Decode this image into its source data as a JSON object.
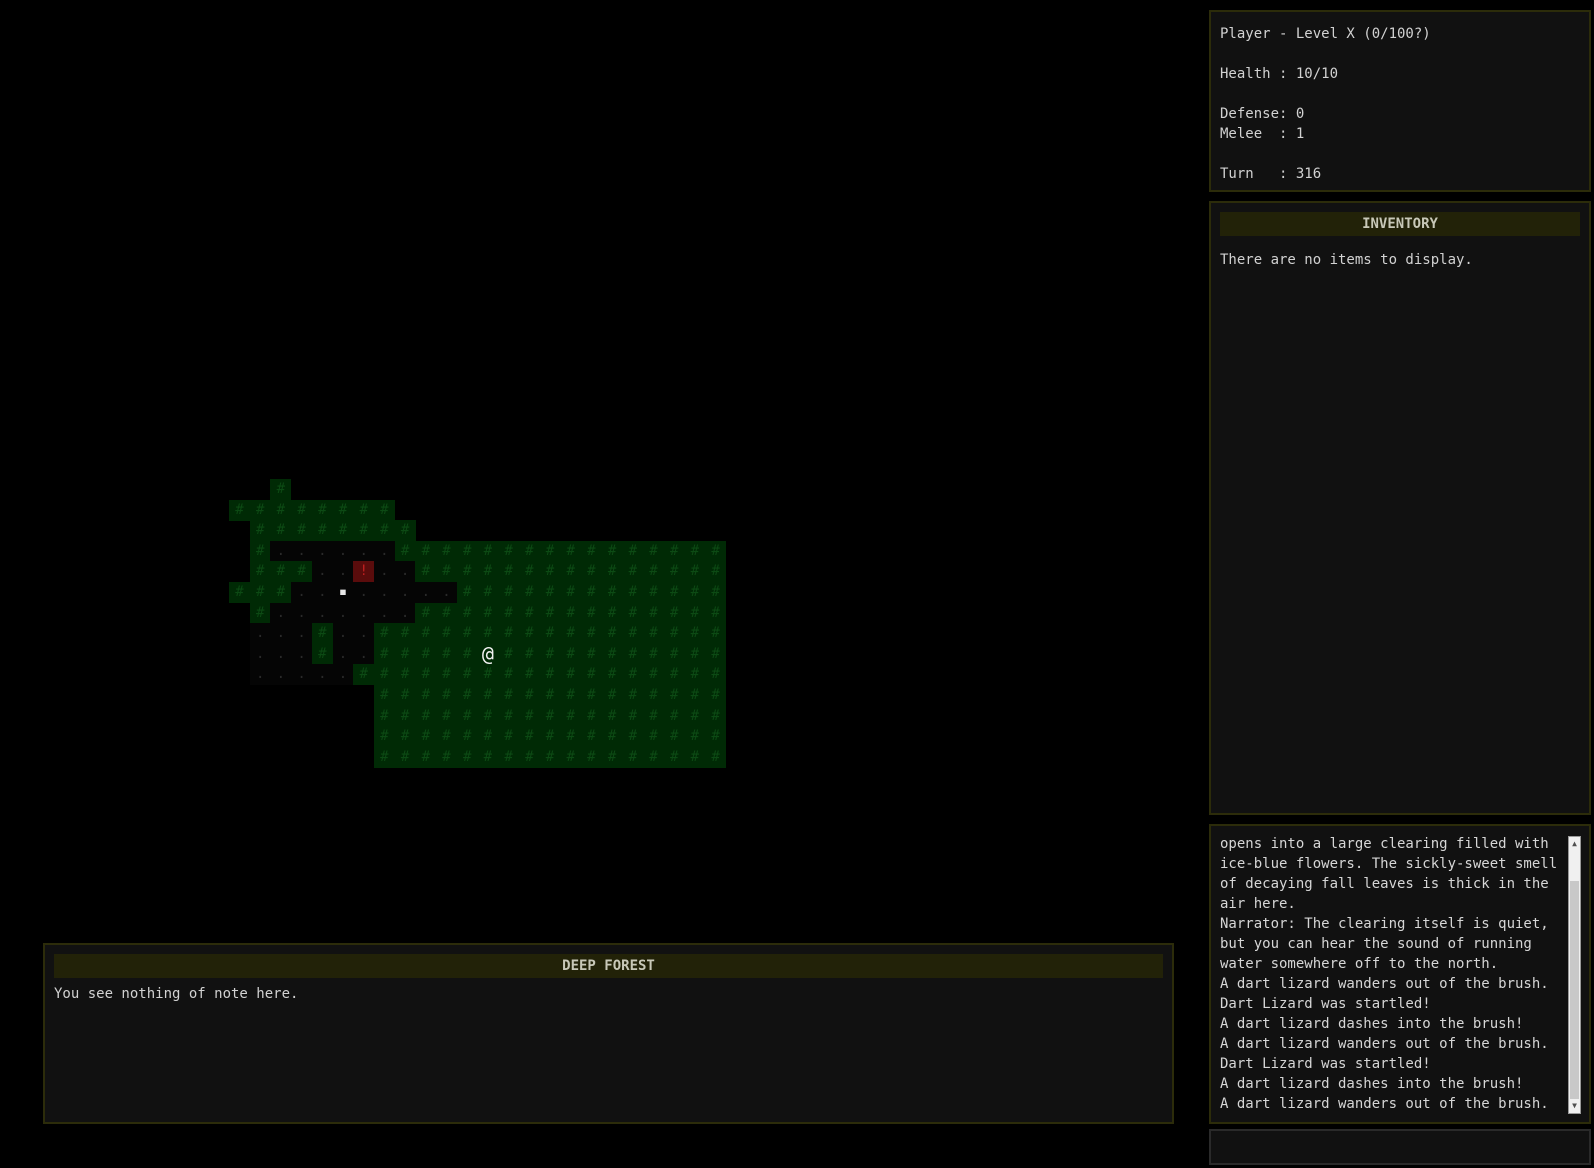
{
  "stats": {
    "title": "Player - Level X (0/100?)",
    "health": "Health : 10/10",
    "defense": "Defense: 0",
    "melee": "Melee  : 1",
    "turn": "Turn   : 316"
  },
  "inventory": {
    "title": "INVENTORY",
    "empty_text": "There are no items to display."
  },
  "location": {
    "title": "DEEP FOREST",
    "description": "You see nothing of note here."
  },
  "message_log": [
    "opens into a large clearing filled with ice-blue flowers. The sickly-sweet smell of decaying fall leaves is thick in the air here.",
    "Narrator: The clearing itself is quiet, but you can hear the sound of running water somewhere off to the north.",
    "A dart lizard wanders out of the brush.",
    "Dart Lizard was startled!",
    "A dart lizard dashes into the brush!",
    "A dart lizard wanders out of the brush.",
    "Dart Lizard was startled!",
    "A dart lizard dashes into the brush!",
    "A dart lizard wanders out of the brush."
  ],
  "command_input": {
    "value": ""
  },
  "map": {
    "glyphs": {
      "tree": "#",
      "floor": ".",
      "player": "@",
      "monster": "!",
      "water": "▪"
    },
    "colors": {
      "tree_bg": "#002a05",
      "tree_fg": "#0c4a14",
      "monster_bg": "#5a0c0c",
      "monster_fg": "#c02020",
      "player_fg": "#f0f0f0"
    },
    "rows": [
      "..T.............................",
      "T#######........................",
      ".########.......................",
      ".#......################........",
      ".###..M..###############........",
      "###..W.....#############........",
      ".#.......###############........",
      "....#..#################........",
      "....#..#####@###########........",
      "......##################........",
      ".......#################........",
      ".......#################........",
      ".......#################........",
      ".......#################........"
    ]
  }
}
